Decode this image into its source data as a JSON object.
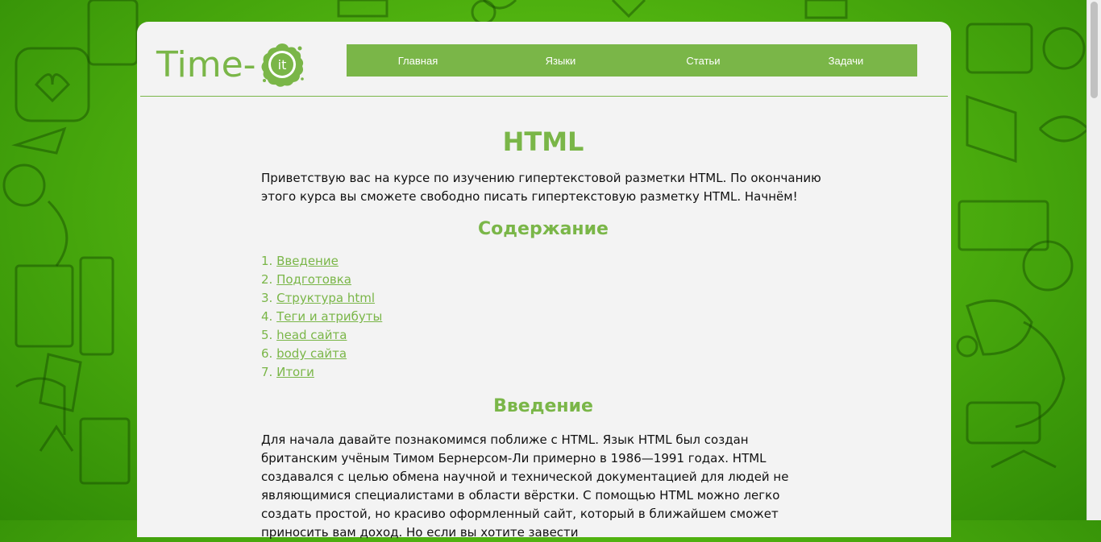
{
  "site": {
    "logo_text": "Time-",
    "logo_badge_text": "it"
  },
  "nav": {
    "items": [
      {
        "label": "Главная"
      },
      {
        "label": "Языки"
      },
      {
        "label": "Статьи"
      },
      {
        "label": "Задачи"
      }
    ]
  },
  "main": {
    "title": "HTML",
    "intro": "Приветствую вас на курсе по изучению гипертекстовой разметки HTML. По окончанию этого курса вы сможете свободно писать гипертекстовую разметку HTML. Начнём!",
    "toc_heading": "Содержание",
    "toc": [
      {
        "num": "1.",
        "label": "Введение"
      },
      {
        "num": "2.",
        "label": "Подготовка"
      },
      {
        "num": "3.",
        "label": "Структура html"
      },
      {
        "num": "4.",
        "label": "Теги и атрибуты"
      },
      {
        "num": "5.",
        "label": "head сайта"
      },
      {
        "num": "6.",
        "label": "body сайта"
      },
      {
        "num": "7.",
        "label": "Итоги"
      }
    ],
    "section_heading": "Введение",
    "section_text": "Для начала давайте познакомимся поближе с HTML. Язык HTML был создан британским учёным Тимом Бернерсом-Ли примерно в 1986—1991 годах. HTML создавался с целью обмена научной и технической документацией для людей не являющимися специалистами в области вёрстки. С помощью HTML можно легко создать простой, но красиво оформленный сайт, который в ближайшем сможет приносить вам доход. Но если вы хотите завести"
  },
  "colors": {
    "accent": "#7ab648",
    "background": "#4fb10f",
    "card": "#f3f3f3"
  }
}
